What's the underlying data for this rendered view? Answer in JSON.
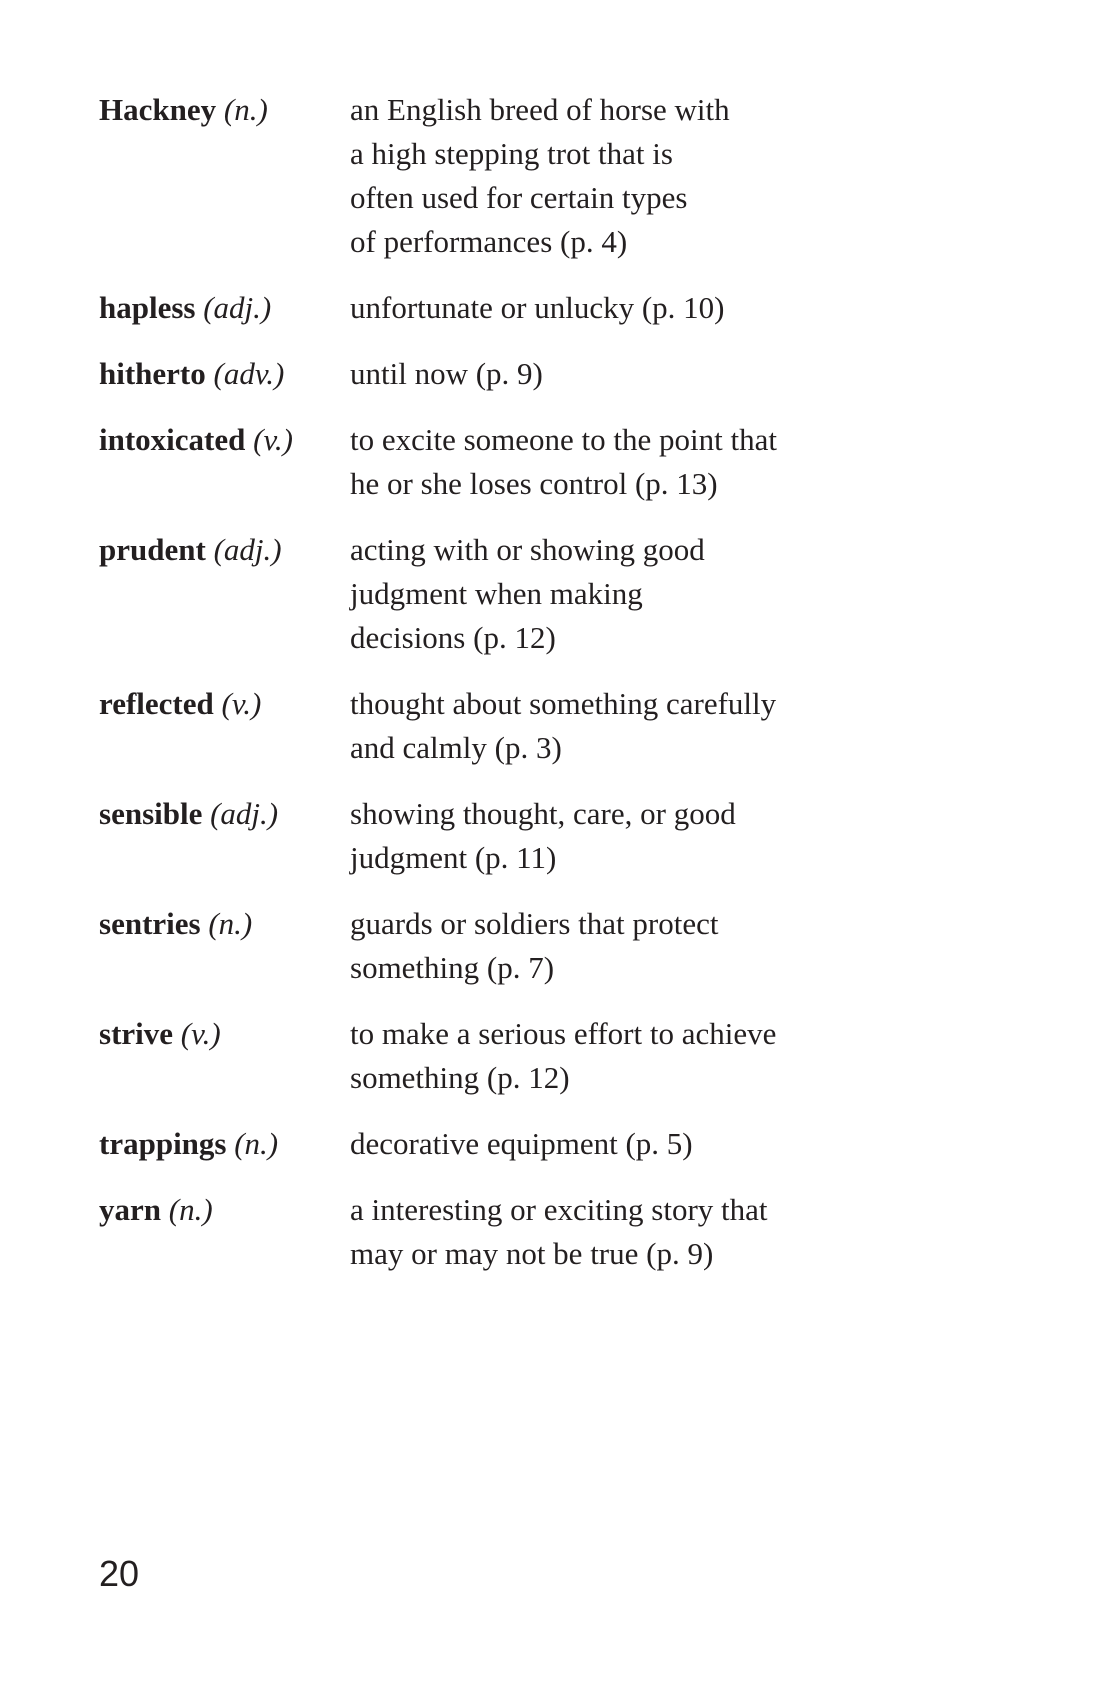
{
  "entries": [
    {
      "word": "Hackney",
      "pos": "(n.)",
      "definition_lines": [
        "an English breed of horse with",
        "a high stepping trot that is",
        "often used for certain types",
        "of performances (p. 4)"
      ]
    },
    {
      "word": "hapless",
      "pos": "(adj.)",
      "definition_lines": [
        "unfortunate or unlucky (p. 10)"
      ]
    },
    {
      "word": "hitherto",
      "pos": "(adv.)",
      "definition_lines": [
        "until now (p. 9)"
      ]
    },
    {
      "word": "intoxicated",
      "pos": "(v.)",
      "definition_lines": [
        "to excite someone to the point that",
        "he or she loses control (p. 13)"
      ]
    },
    {
      "word": "prudent",
      "pos": "(adj.)",
      "definition_lines": [
        "acting with or showing good",
        "judgment when making",
        "decisions (p. 12)"
      ]
    },
    {
      "word": "reflected",
      "pos": "(v.)",
      "definition_lines": [
        "thought about something carefully",
        "and calmly (p. 3)"
      ]
    },
    {
      "word": "sensible",
      "pos": "(adj.)",
      "definition_lines": [
        "showing thought, care, or good",
        "judgment (p. 11)"
      ]
    },
    {
      "word": "sentries",
      "pos": "(n.)",
      "definition_lines": [
        "guards or soldiers that protect",
        "something (p. 7)"
      ]
    },
    {
      "word": "strive",
      "pos": "(v.)",
      "definition_lines": [
        "to make a serious effort to achieve",
        "something (p. 12)"
      ]
    },
    {
      "word": "trappings",
      "pos": "(n.)",
      "definition_lines": [
        "decorative equipment (p. 5)"
      ]
    },
    {
      "word": "yarn",
      "pos": "(n.)",
      "definition_lines": [
        "a interesting or exciting story that",
        "may or may not be true (p. 9)"
      ]
    }
  ],
  "page_number": "20"
}
